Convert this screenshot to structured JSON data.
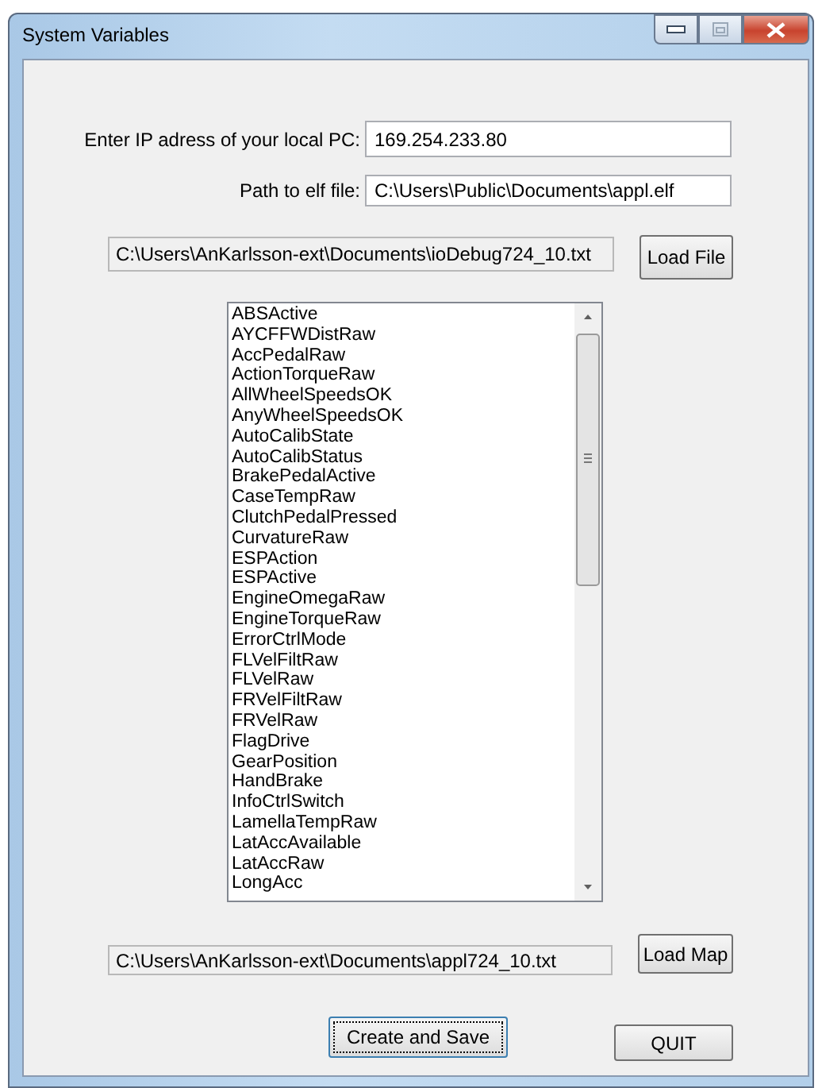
{
  "window": {
    "title": "System Variables"
  },
  "ip_field": {
    "label": "Enter IP adress of your local PC:",
    "value": "169.254.233.80"
  },
  "elf_field": {
    "label": "Path to elf file:",
    "value": "C:\\Users\\Public\\Documents\\appl.elf"
  },
  "debug_file": {
    "value": "C:\\Users\\AnKarlsson-ext\\Documents\\ioDebug724_10.txt",
    "button": "Load File"
  },
  "variables": [
    "ABSActive",
    "AYCFFWDistRaw",
    "AccPedalRaw",
    "ActionTorqueRaw",
    "AllWheelSpeedsOK",
    "AnyWheelSpeedsOK",
    "AutoCalibState",
    "AutoCalibStatus",
    "BrakePedalActive",
    "CaseTempRaw",
    "ClutchPedalPressed",
    "CurvatureRaw",
    "ESPAction",
    "ESPActive",
    "EngineOmegaRaw",
    "EngineTorqueRaw",
    "ErrorCtrlMode",
    "FLVelFiltRaw",
    "FLVelRaw",
    "FRVelFiltRaw",
    "FRVelRaw",
    "FlagDrive",
    "GearPosition",
    "HandBrake",
    "InfoCtrlSwitch",
    "LamellaTempRaw",
    "LatAccAvailable",
    "LatAccRaw",
    "LongAcc"
  ],
  "map_file": {
    "value": "C:\\Users\\AnKarlsson-ext\\Documents\\appl724_10.txt",
    "button": "Load Map"
  },
  "buttons": [
    {
      "label": "Create and Save",
      "kind": "create",
      "focused": true
    },
    {
      "label": "QUIT",
      "kind": "quit",
      "focused": false
    }
  ]
}
